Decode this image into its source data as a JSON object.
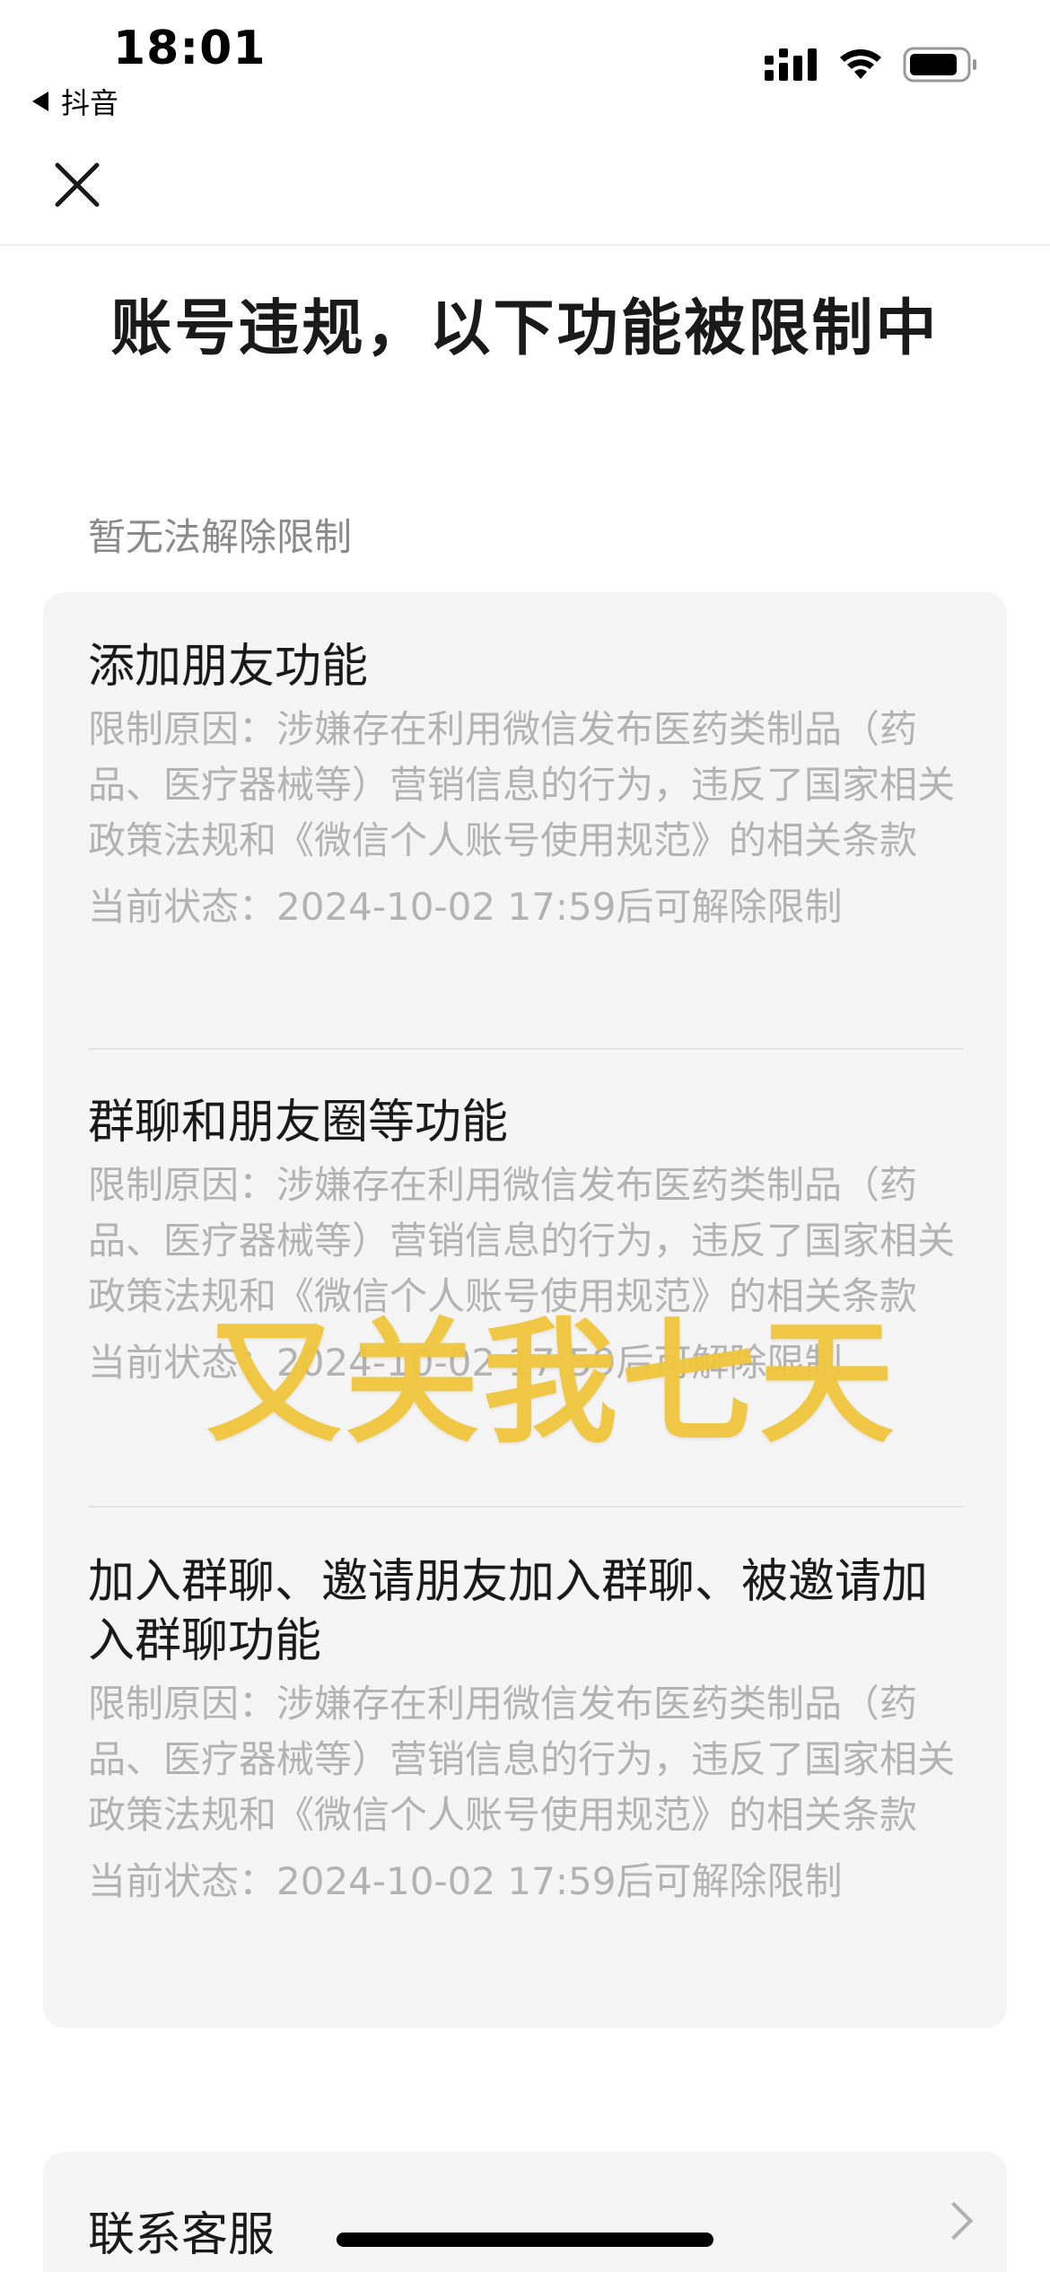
{
  "status_bar": {
    "time": "18:01",
    "back_app": "抖音"
  },
  "title": "账号违规，以下功能被限制中",
  "section_label": "暂无法解除限制",
  "restrictions": [
    {
      "title": "添加朋友功能",
      "reason": "限制原因：涉嫌存在利用微信发布医药类制品（药品、医疗器械等）营销信息的行为，违反了国家相关政策法规和《微信个人账号使用规范》的相关条款",
      "status": "当前状态：2024-10-02 17:59后可解除限制"
    },
    {
      "title": "群聊和朋友圈等功能",
      "reason": "限制原因：涉嫌存在利用微信发布医药类制品（药品、医疗器械等）营销信息的行为，违反了国家相关政策法规和《微信个人账号使用规范》的相关条款",
      "status": "当前状态：2024-10-02 17:59后可解除限制"
    },
    {
      "title": "加入群聊、邀请朋友加入群聊、被邀请加入群聊功能",
      "reason": "限制原因：涉嫌存在利用微信发布医药类制品（药品、医疗器械等）营销信息的行为，违反了国家相关政策法规和《微信个人账号使用规范》的相关条款",
      "status": "当前状态：2024-10-02 17:59后可解除限制"
    }
  ],
  "overlay_text": "又关我七天",
  "contact": {
    "label": "联系客服"
  },
  "colors": {
    "overlay": "#f0c63c",
    "card_bg": "#f5f5f5",
    "muted_text": "#b3b3b3"
  },
  "icons": {
    "close": "close-icon",
    "chevron": "chevron-right-icon",
    "signal": "signal-icon",
    "wifi": "wifi-icon",
    "battery": "battery-icon",
    "back": "back-triangle-icon"
  }
}
